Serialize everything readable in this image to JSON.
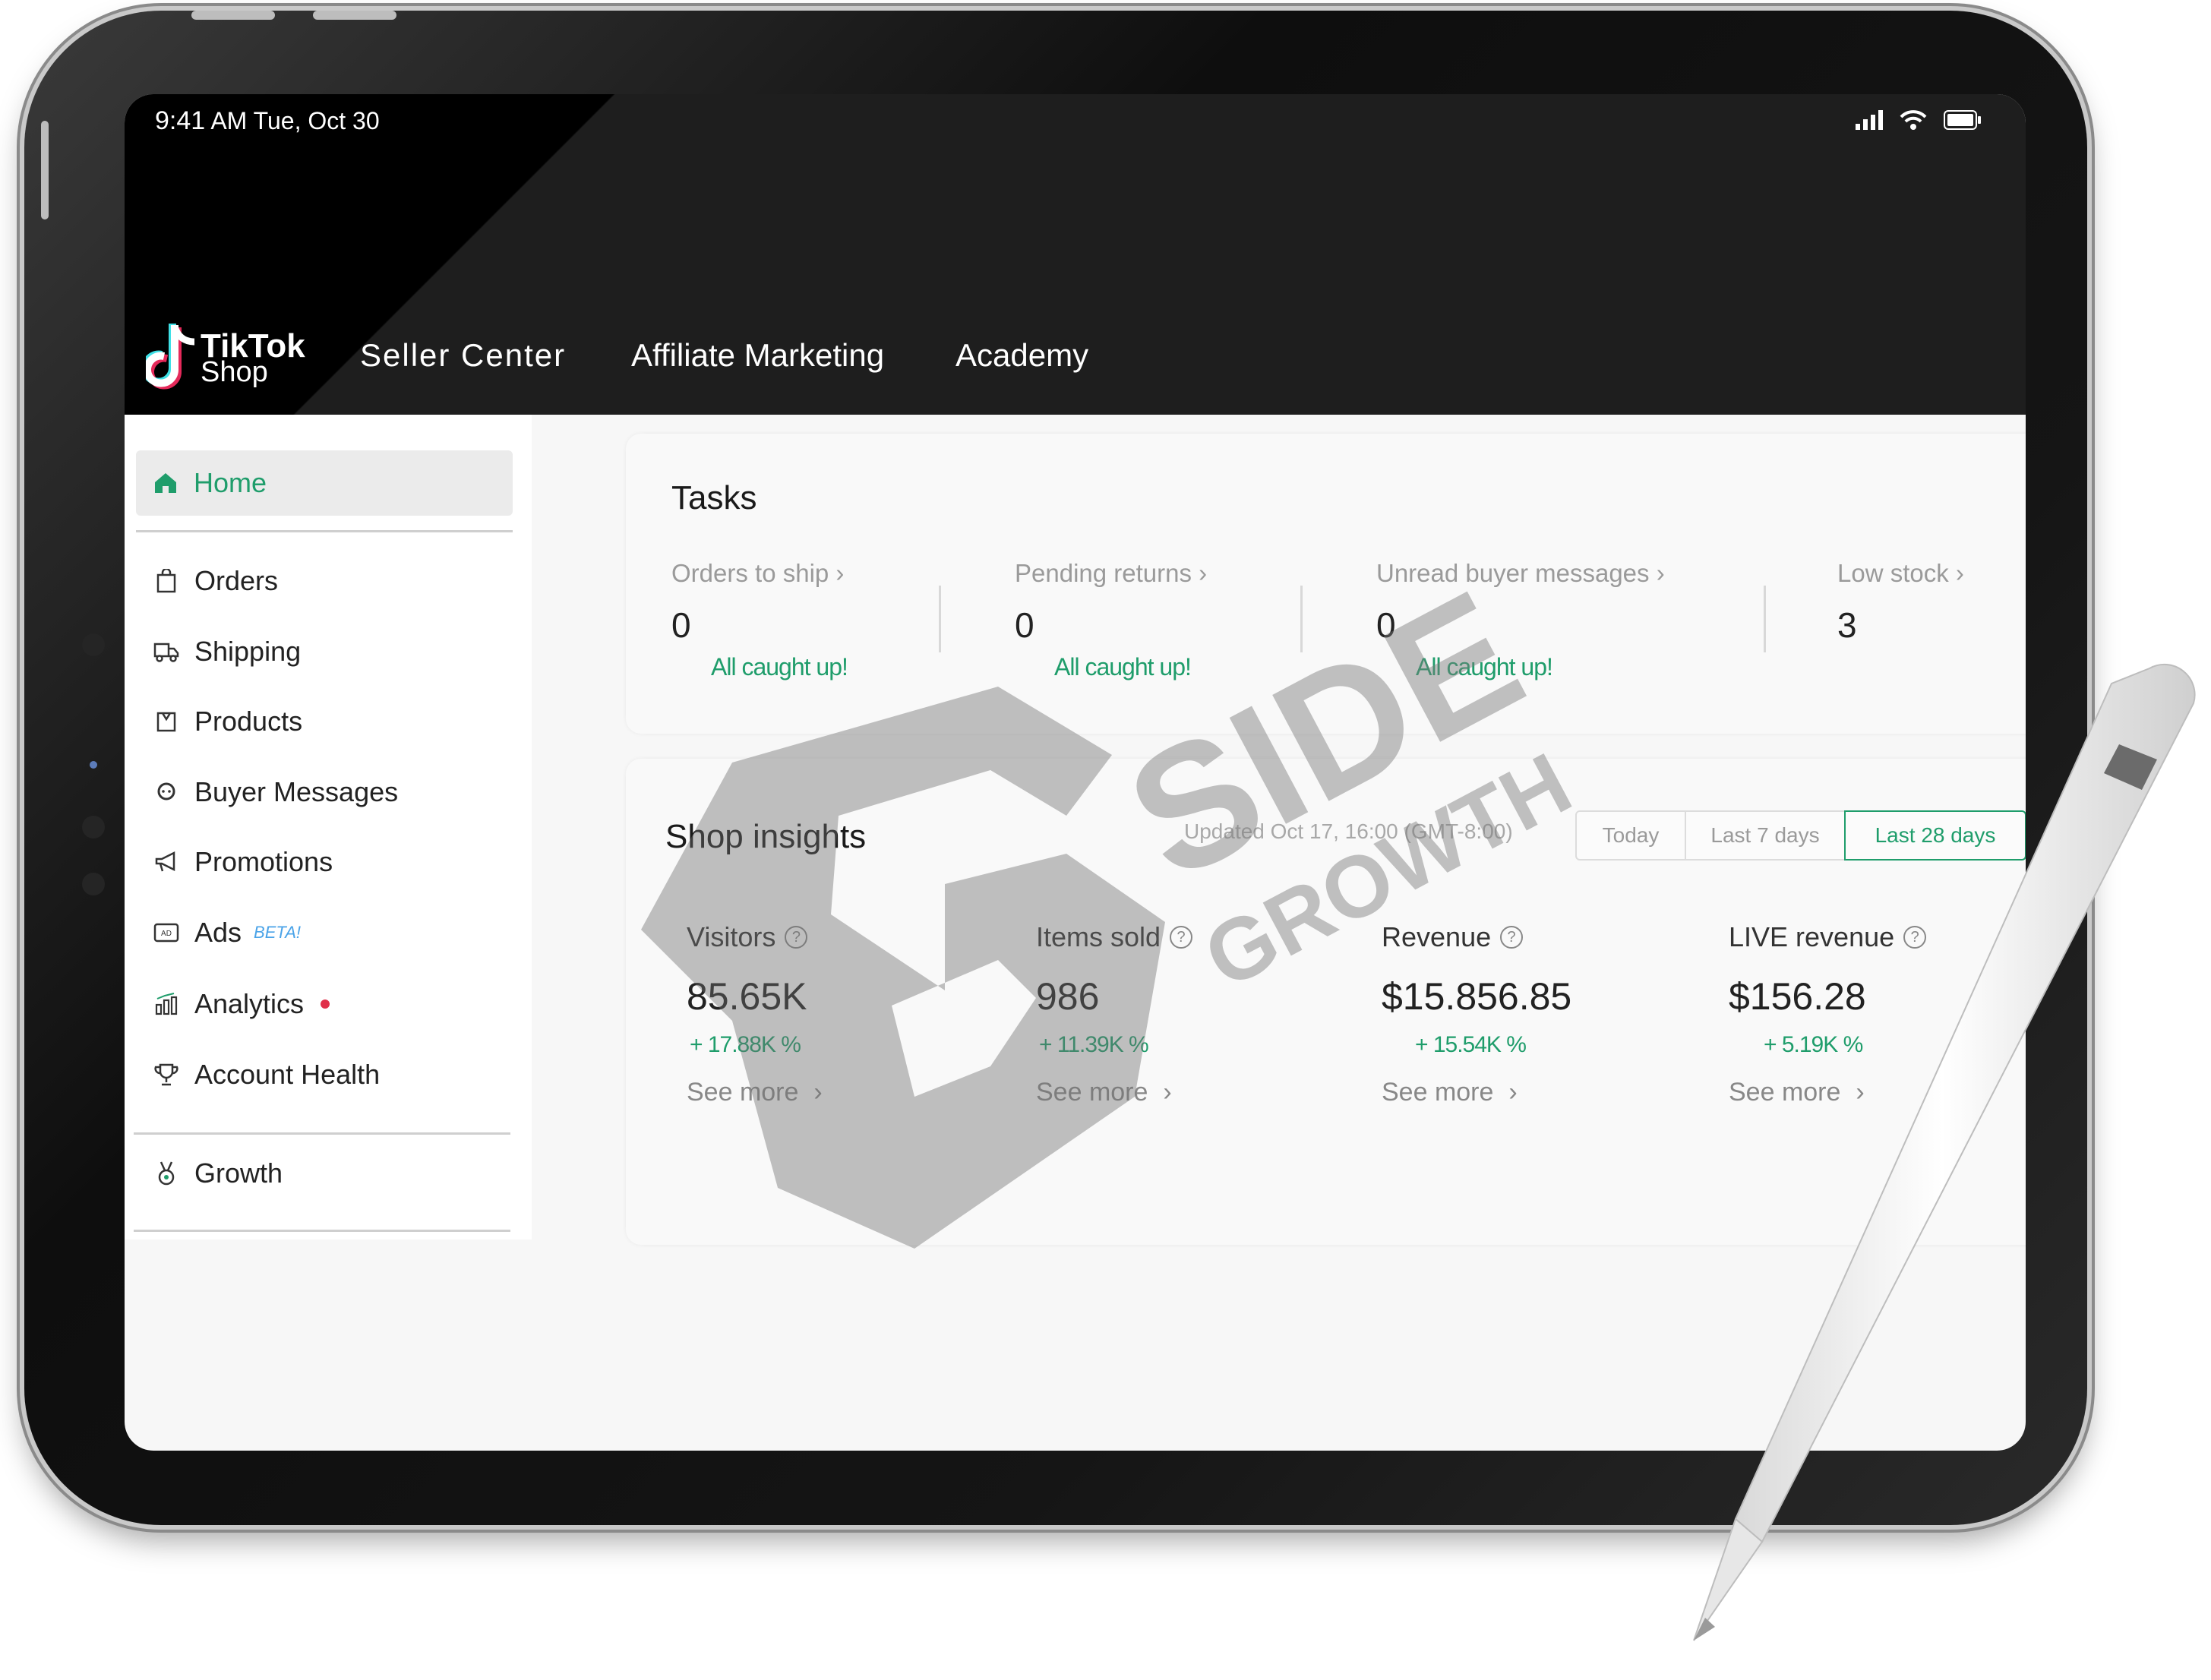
{
  "status_bar": {
    "time": "9:41",
    "date": "AM Tue, Oct 30"
  },
  "brand": {
    "line1": "TikTok",
    "line2": "Shop"
  },
  "nav": {
    "seller_center": "Seller Center",
    "affiliate": "Affiliate Marketing",
    "academy": "Academy"
  },
  "sidebar": {
    "home": "Home",
    "items": [
      "Orders",
      "Shipping",
      "Products",
      "Buyer Messages",
      "Promotions",
      "Ads",
      "Analytics",
      "Account Health"
    ],
    "ads_badge": "BETA!",
    "growth": "Growth"
  },
  "tasks": {
    "title": "Tasks",
    "cols": [
      {
        "label": "Orders to ship",
        "value": "0",
        "status": "All caught up!"
      },
      {
        "label": "Pending returns",
        "value": "0",
        "status": "All caught up!"
      },
      {
        "label": "Unread buyer messages",
        "value": "0",
        "status": "All caught up!"
      },
      {
        "label": "Low stock",
        "value": "3"
      }
    ]
  },
  "insights": {
    "title": "Shop insights",
    "updated": "Updated Oct 17, 16:00  (GMT-8:00)",
    "ranges": [
      "Today",
      "Last 7 days",
      "Last 28 days"
    ],
    "selected_range": "Last 28 days",
    "metrics": [
      {
        "label": "Visitors",
        "value": "85.65K",
        "delta": "+ 17.88K %",
        "more": "See more"
      },
      {
        "label": "Items sold",
        "value": "986",
        "delta": "+ 11.39K %",
        "more": "See more"
      },
      {
        "label": "Revenue",
        "value": "$15.856.85",
        "delta": "+ 15.54K %",
        "more": "See more"
      },
      {
        "label": "LIVE revenue",
        "value": "$156.28",
        "delta": "+ 5.19K %",
        "more": "See more"
      }
    ]
  },
  "watermark": {
    "line1": "SIDE",
    "line2": "GROWTH"
  },
  "colors": {
    "accent": "#1f9d6b",
    "topbar": "#1e1e1e",
    "badge": "#4aa3e8",
    "dot": "#e0304a"
  }
}
